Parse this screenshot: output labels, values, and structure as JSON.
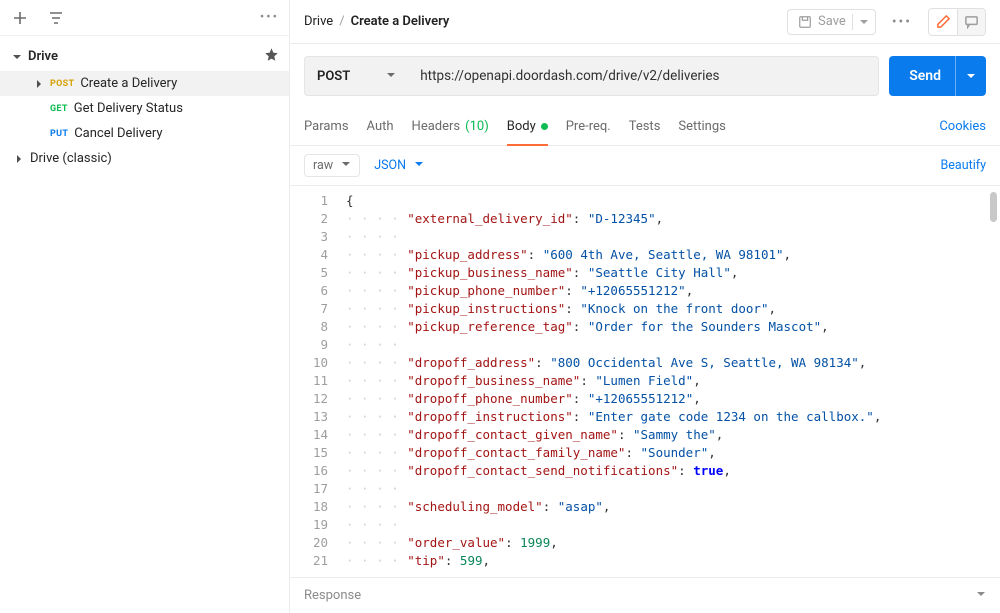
{
  "sidebar": {
    "collection": "Drive",
    "items": [
      {
        "method": "POST",
        "method_class": "post",
        "label": "Create a Delivery",
        "selected": true
      },
      {
        "method": "GET",
        "method_class": "get",
        "label": "Get Delivery Status",
        "selected": false
      },
      {
        "method": "PUT",
        "method_class": "put",
        "label": "Cancel Delivery",
        "selected": false
      }
    ],
    "other_collection": "Drive (classic)"
  },
  "breadcrumb": {
    "root": "Drive",
    "sep": "/",
    "current": "Create a Delivery"
  },
  "topbar": {
    "save_label": "Save"
  },
  "request": {
    "method": "POST",
    "url": "https://openapi.doordash.com/drive/v2/deliveries",
    "send_label": "Send"
  },
  "tabs": {
    "params": "Params",
    "auth": "Auth",
    "headers": "Headers",
    "headers_count": "(10)",
    "body": "Body",
    "prereq": "Pre-req.",
    "tests": "Tests",
    "settings": "Settings",
    "cookies": "Cookies"
  },
  "subtabs": {
    "mode": "raw",
    "lang": "JSON",
    "beautify": "Beautify"
  },
  "body_lines": [
    {
      "n": 1,
      "indent": 0,
      "tokens": [
        {
          "t": "punc",
          "v": "{"
        }
      ]
    },
    {
      "n": 2,
      "indent": 1,
      "tokens": [
        {
          "t": "key",
          "v": "\"external_delivery_id\""
        },
        {
          "t": "punc",
          "v": ": "
        },
        {
          "t": "str",
          "v": "\"D-12345\""
        },
        {
          "t": "punc",
          "v": ","
        }
      ]
    },
    {
      "n": 3,
      "indent": 1,
      "tokens": []
    },
    {
      "n": 4,
      "indent": 1,
      "tokens": [
        {
          "t": "key",
          "v": "\"pickup_address\""
        },
        {
          "t": "punc",
          "v": ": "
        },
        {
          "t": "str",
          "v": "\"600 4th Ave, Seattle, WA 98101\""
        },
        {
          "t": "punc",
          "v": ","
        }
      ]
    },
    {
      "n": 5,
      "indent": 1,
      "tokens": [
        {
          "t": "key",
          "v": "\"pickup_business_name\""
        },
        {
          "t": "punc",
          "v": ": "
        },
        {
          "t": "str",
          "v": "\"Seattle City Hall\""
        },
        {
          "t": "punc",
          "v": ","
        }
      ]
    },
    {
      "n": 6,
      "indent": 1,
      "tokens": [
        {
          "t": "key",
          "v": "\"pickup_phone_number\""
        },
        {
          "t": "punc",
          "v": ": "
        },
        {
          "t": "str",
          "v": "\"+12065551212\""
        },
        {
          "t": "punc",
          "v": ","
        }
      ]
    },
    {
      "n": 7,
      "indent": 1,
      "tokens": [
        {
          "t": "key",
          "v": "\"pickup_instructions\""
        },
        {
          "t": "punc",
          "v": ": "
        },
        {
          "t": "str",
          "v": "\"Knock on the front door\""
        },
        {
          "t": "punc",
          "v": ","
        }
      ]
    },
    {
      "n": 8,
      "indent": 1,
      "tokens": [
        {
          "t": "key",
          "v": "\"pickup_reference_tag\""
        },
        {
          "t": "punc",
          "v": ": "
        },
        {
          "t": "str",
          "v": "\"Order for the Sounders Mascot\""
        },
        {
          "t": "punc",
          "v": ","
        }
      ]
    },
    {
      "n": 9,
      "indent": 1,
      "tokens": []
    },
    {
      "n": 10,
      "indent": 1,
      "tokens": [
        {
          "t": "key",
          "v": "\"dropoff_address\""
        },
        {
          "t": "punc",
          "v": ": "
        },
        {
          "t": "str",
          "v": "\"800 Occidental Ave S, Seattle, WA 98134\""
        },
        {
          "t": "punc",
          "v": ","
        }
      ]
    },
    {
      "n": 11,
      "indent": 1,
      "tokens": [
        {
          "t": "key",
          "v": "\"dropoff_business_name\""
        },
        {
          "t": "punc",
          "v": ": "
        },
        {
          "t": "str",
          "v": "\"Lumen Field\""
        },
        {
          "t": "punc",
          "v": ","
        }
      ]
    },
    {
      "n": 12,
      "indent": 1,
      "tokens": [
        {
          "t": "key",
          "v": "\"dropoff_phone_number\""
        },
        {
          "t": "punc",
          "v": ": "
        },
        {
          "t": "str",
          "v": "\"+12065551212\""
        },
        {
          "t": "punc",
          "v": ","
        }
      ]
    },
    {
      "n": 13,
      "indent": 1,
      "tokens": [
        {
          "t": "key",
          "v": "\"dropoff_instructions\""
        },
        {
          "t": "punc",
          "v": ": "
        },
        {
          "t": "str",
          "v": "\"Enter gate code 1234 on the callbox.\""
        },
        {
          "t": "punc",
          "v": ","
        }
      ]
    },
    {
      "n": 14,
      "indent": 1,
      "tokens": [
        {
          "t": "key",
          "v": "\"dropoff_contact_given_name\""
        },
        {
          "t": "punc",
          "v": ": "
        },
        {
          "t": "str",
          "v": "\"Sammy the\""
        },
        {
          "t": "punc",
          "v": ","
        }
      ]
    },
    {
      "n": 15,
      "indent": 1,
      "tokens": [
        {
          "t": "key",
          "v": "\"dropoff_contact_family_name\""
        },
        {
          "t": "punc",
          "v": ": "
        },
        {
          "t": "str",
          "v": "\"Sounder\""
        },
        {
          "t": "punc",
          "v": ","
        }
      ]
    },
    {
      "n": 16,
      "indent": 1,
      "tokens": [
        {
          "t": "key",
          "v": "\"dropoff_contact_send_notifications\""
        },
        {
          "t": "punc",
          "v": ": "
        },
        {
          "t": "bool",
          "v": "true"
        },
        {
          "t": "punc",
          "v": ","
        }
      ]
    },
    {
      "n": 17,
      "indent": 1,
      "tokens": []
    },
    {
      "n": 18,
      "indent": 1,
      "tokens": [
        {
          "t": "key",
          "v": "\"scheduling_model\""
        },
        {
          "t": "punc",
          "v": ": "
        },
        {
          "t": "str",
          "v": "\"asap\""
        },
        {
          "t": "punc",
          "v": ","
        }
      ]
    },
    {
      "n": 19,
      "indent": 1,
      "tokens": []
    },
    {
      "n": 20,
      "indent": 1,
      "tokens": [
        {
          "t": "key",
          "v": "\"order_value\""
        },
        {
          "t": "punc",
          "v": ": "
        },
        {
          "t": "num",
          "v": "1999"
        },
        {
          "t": "punc",
          "v": ","
        }
      ]
    },
    {
      "n": 21,
      "indent": 1,
      "tokens": [
        {
          "t": "key",
          "v": "\"tip\""
        },
        {
          "t": "punc",
          "v": ": "
        },
        {
          "t": "num",
          "v": "599"
        },
        {
          "t": "punc",
          "v": ","
        }
      ]
    }
  ],
  "response": {
    "label": "Response"
  }
}
